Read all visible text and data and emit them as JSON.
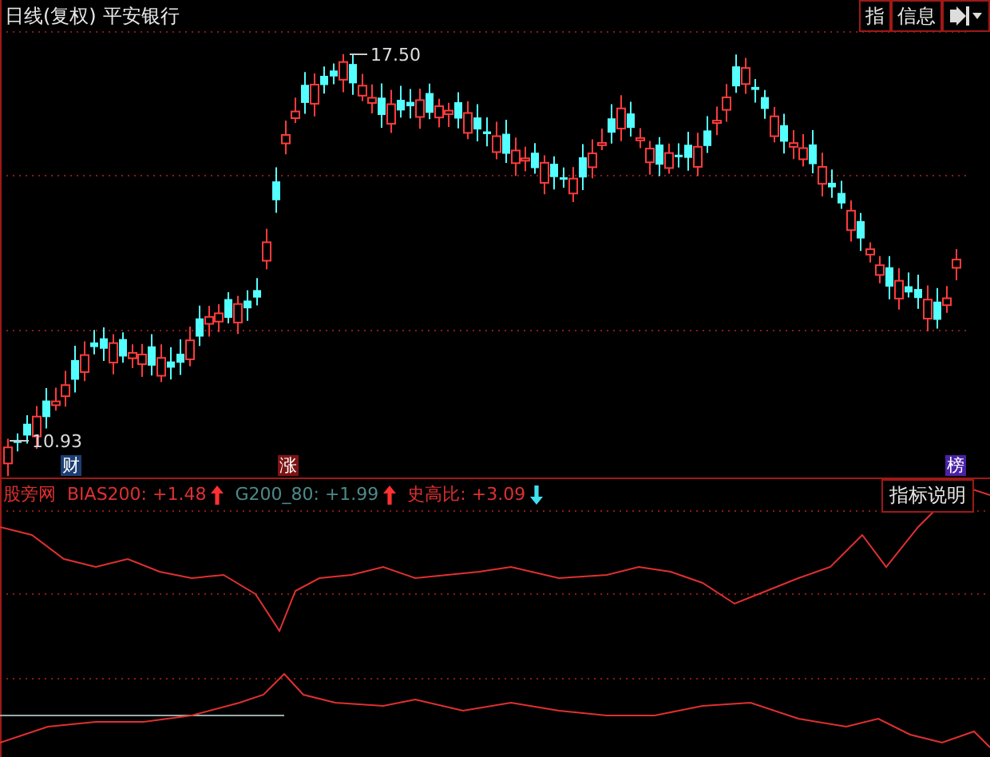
{
  "title": {
    "period": "日线(复权)",
    "stock": "平安银行"
  },
  "toolbar": [
    {
      "kind": "text",
      "label": "指"
    },
    {
      "kind": "text",
      "label": "信息"
    },
    {
      "kind": "play-menu"
    }
  ],
  "price_chart": {
    "high_label": "17.50",
    "low_label": "10.93",
    "markers": [
      {
        "label": "财",
        "color": "#1c3f73"
      },
      {
        "label": "涨",
        "color": "#7c1414"
      },
      {
        "label": "榜",
        "color": "#4a22a6"
      }
    ]
  },
  "indicator": {
    "name": "股旁网",
    "values": [
      {
        "label": "BIAS200: +1.48",
        "color": "#e03030",
        "rising": true
      },
      {
        "label": "G200_80: +1.99",
        "color": "#4f8a8a",
        "rising": true
      },
      {
        "label": "史高比: +3.09",
        "color": "#e03030",
        "rising": false
      }
    ],
    "help_button": "指标说明"
  }
}
